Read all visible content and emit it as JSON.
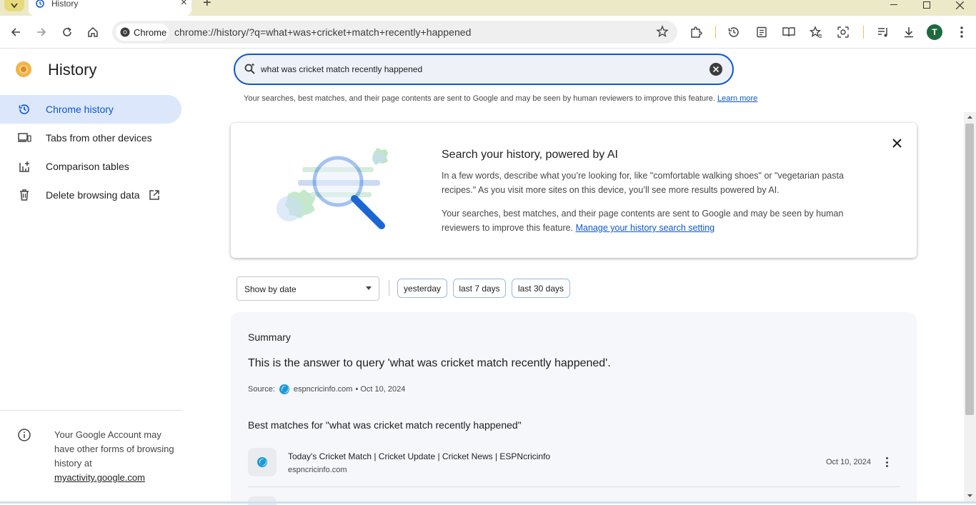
{
  "tab": {
    "title": "History"
  },
  "toolbar": {
    "chip_label": "Chrome",
    "url": "chrome://history/?q=what+was+cricket+match+recently+happened",
    "avatar_initial": "T"
  },
  "sidebar": {
    "title": "History",
    "items": [
      {
        "label": "Chrome history",
        "icon": "history-icon",
        "active": true
      },
      {
        "label": "Tabs from other devices",
        "icon": "devices-icon",
        "active": false
      },
      {
        "label": "Comparison tables",
        "icon": "comparison-table-icon",
        "active": false
      },
      {
        "label": "Delete browsing data",
        "icon": "trash-icon",
        "active": false
      }
    ],
    "footer_text": "Your Google Account may have other forms of browsing history at",
    "footer_link": "myactivity.google.com"
  },
  "search": {
    "query": "what was cricket match recently happened",
    "disclaimer": "Your searches, best matches, and their page contents are sent to Google and may be seen by human reviewers to improve this feature.",
    "learn_more": "Learn more"
  },
  "promo": {
    "title": "Search your history, powered by AI",
    "p1": "In a few words, describe what you’re looking for, like \"comfortable walking shoes\" or \"vegetarian pasta recipes.\" As you visit more sites on this device, you’ll see more results powered by AI.",
    "p2": "Your searches, best matches, and their page contents are sent to Google and may be seen by human reviewers to improve this feature.",
    "p2_link": "Manage your history search setting"
  },
  "filters": {
    "select_value": "Show by date",
    "chips": [
      "yesterday",
      "last 7 days",
      "last 30 days"
    ]
  },
  "summary": {
    "heading": "Summary",
    "answer": "This is the answer to query 'what was cricket match recently happened'.",
    "source_label": "Source:",
    "source_domain": "espncricinfo.com",
    "source_date": "• Oct 10, 2024",
    "best_heading": "Best matches for \"what was cricket match recently happened\"",
    "results": [
      {
        "title": "Today's Cricket Match | Cricket Update | Cricket News | ESPNcricinfo",
        "domain": "espncricinfo.com",
        "date": "Oct 10, 2024"
      }
    ]
  },
  "colors": {
    "accent": "#0b57d0",
    "active_nav_bg": "#dce7fb",
    "tabstrip_bg": "#ece9c8"
  }
}
